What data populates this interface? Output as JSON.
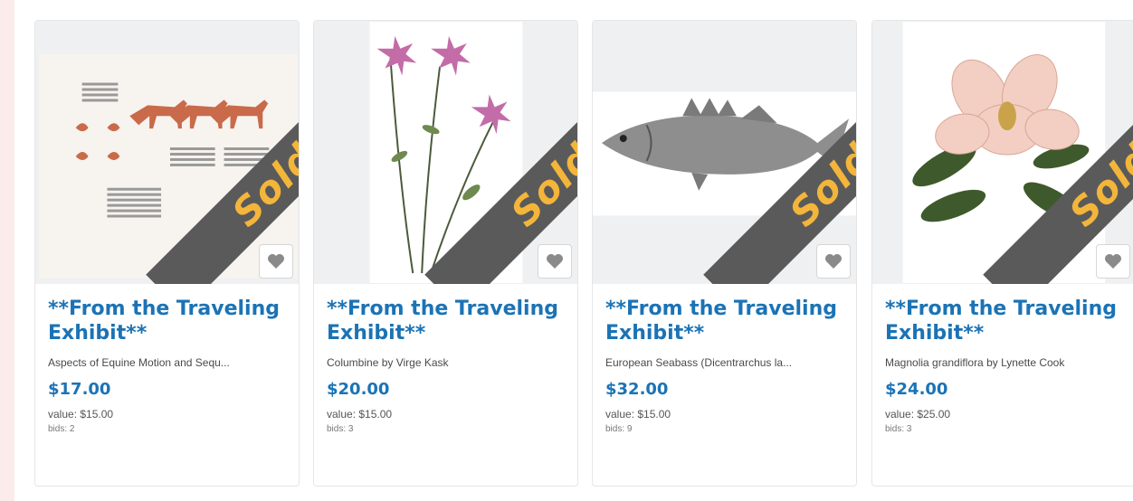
{
  "sold_label": "Sold!",
  "colors": {
    "title": "#1b73b5",
    "sold_band": "#5a5a5a",
    "sold_text": "#f3b53a",
    "background": "#fbeceb"
  },
  "cards": [
    {
      "title": "**From the Traveling Exhibit**",
      "subtitle": "Aspects of Equine Motion and Sequ...",
      "price": "$17.00",
      "value": "value: $15.00",
      "bids": "bids: 2",
      "image_icon": "horse-motion-illustration"
    },
    {
      "title": "**From the Traveling Exhibit**",
      "subtitle": "Columbine by Virge Kask",
      "price": "$20.00",
      "value": "value: $15.00",
      "bids": "bids: 3",
      "image_icon": "columbine-flower-illustration"
    },
    {
      "title": "**From the Traveling Exhibit**",
      "subtitle": "European Seabass (Dicentrarchus la...",
      "price": "$32.00",
      "value": "value: $15.00",
      "bids": "bids: 9",
      "image_icon": "seabass-fish-illustration"
    },
    {
      "title": "**From the Traveling Exhibit**",
      "subtitle": "Magnolia grandiflora by Lynette Cook",
      "price": "$24.00",
      "value": "value: $25.00",
      "bids": "bids: 3",
      "image_icon": "magnolia-flower-illustration"
    }
  ]
}
